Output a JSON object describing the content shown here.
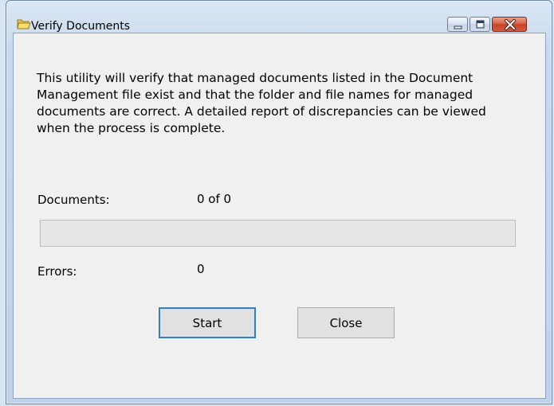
{
  "window": {
    "title": "Verify Documents",
    "icon": "folder-icon",
    "controls": [
      "minimize-icon",
      "maximize-icon",
      "close-icon"
    ]
  },
  "main": {
    "description": "This utility will verify that managed documents listed in the Document Management file exist and that the folder and file names for managed documents are correct.  A detailed report of discrepancies can be viewed when the process is complete.",
    "documents_label": "Documents:",
    "documents_value": "0 of 0",
    "progress_fraction": 0,
    "errors_label": "Errors:",
    "errors_value": "0"
  },
  "buttons": {
    "start_label": "Start",
    "close_label": "Close"
  },
  "colors": {
    "accent": "#3c7fb1",
    "close_button": "#c7442a",
    "progress_fill": "#06b025"
  }
}
